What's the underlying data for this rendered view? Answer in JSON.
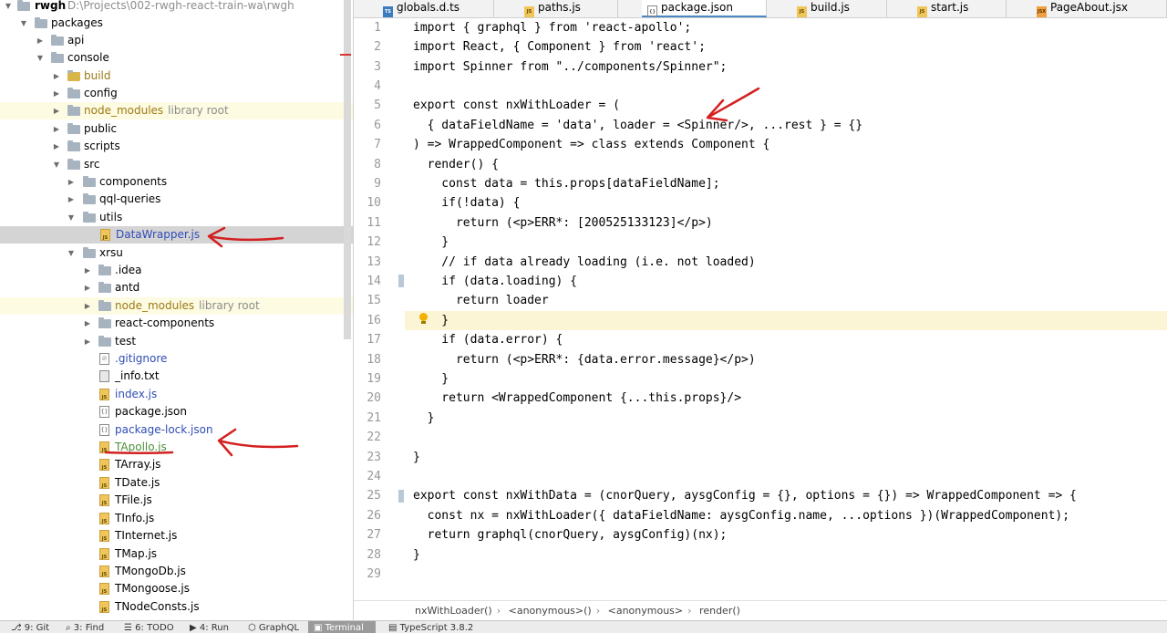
{
  "project_tree": {
    "root": {
      "name": "rwgh",
      "path": "D:\\Projects\\002-rwgh-react-train-wa\\rwgh"
    },
    "items": [
      {
        "label": "packages"
      },
      {
        "label": "api"
      },
      {
        "label": "console"
      },
      {
        "label": "build"
      },
      {
        "label": "config"
      },
      {
        "label": "node_modules",
        "note": "library root"
      },
      {
        "label": "public"
      },
      {
        "label": "scripts"
      },
      {
        "label": "src"
      },
      {
        "label": "components"
      },
      {
        "label": "qql-queries"
      },
      {
        "label": "utils"
      },
      {
        "label": "DataWrapper.js"
      },
      {
        "label": "xrsu"
      },
      {
        "label": ".idea"
      },
      {
        "label": "antd"
      },
      {
        "label": "node_modules",
        "note": "library root"
      },
      {
        "label": "react-components"
      },
      {
        "label": "test"
      },
      {
        "label": ".gitignore"
      },
      {
        "label": "_info.txt"
      },
      {
        "label": "index.js"
      },
      {
        "label": "package.json"
      },
      {
        "label": "package-lock.json"
      },
      {
        "label": "TApollo.js"
      },
      {
        "label": "TArray.js"
      },
      {
        "label": "TDate.js"
      },
      {
        "label": "TFile.js"
      },
      {
        "label": "TInfo.js"
      },
      {
        "label": "TInternet.js"
      },
      {
        "label": "TMap.js"
      },
      {
        "label": "TMongoDb.js"
      },
      {
        "label": "TMongoose.js"
      },
      {
        "label": "TNodeConsts.js"
      }
    ]
  },
  "tabs": [
    {
      "label": "globals.d.ts",
      "icon": "ts-file-icon"
    },
    {
      "label": "paths.js",
      "icon": "js-file-icon"
    },
    {
      "label": "package.json",
      "icon": "json-file-icon"
    },
    {
      "label": "build.js",
      "icon": "js-file-icon"
    },
    {
      "label": "start.js",
      "icon": "js-file-icon"
    },
    {
      "label": "PageAbout.jsx",
      "icon": "jsx-file-icon"
    }
  ],
  "editor": {
    "line_numbers": [
      "1",
      "2",
      "3",
      "4",
      "5",
      "6",
      "7",
      "8",
      "9",
      "10",
      "11",
      "12",
      "13",
      "14",
      "15",
      "16",
      "17",
      "18",
      "19",
      "20",
      "21",
      "22",
      "23",
      "24",
      "25",
      "26",
      "27",
      "28",
      "29"
    ],
    "lines": [
      "import { graphql } from 'react-apollo';",
      "import React, { Component } from 'react';",
      "import Spinner from \"../components/Spinner\";",
      "",
      "export const nxWithLoader = (",
      "  { dataFieldName = 'data', loader = <Spinner/>, ...rest } = {}",
      ") => WrappedComponent => class extends Component {",
      "  render() {",
      "    const data = this.props[dataFieldName];",
      "    if(!data) {",
      "      return (<p>ERR*: [200525133123]</p>)",
      "    }",
      "    // if data already loading (i.e. not loaded)",
      "    if (data.loading) {",
      "      return loader",
      "    }",
      "    if (data.error) {",
      "      return (<p>ERR*: {data.error.message}</p>)",
      "    }",
      "    return <WrappedComponent {...this.props}/>",
      "  }",
      "",
      "}",
      "",
      "export const nxWithData = (cnorQuery, aysgConfig = {}, options = {}) => WrappedComponent => {",
      "  const nx = nxWithLoader({ dataFieldName: aysgConfig.name, ...options })(WrappedComponent);",
      "  return graphql(cnorQuery, aysgConfig)(nx);",
      "}",
      ""
    ]
  },
  "breadcrumb": [
    "nxWithLoader()",
    "<anonymous>()",
    "<anonymous>",
    "render()"
  ],
  "bottom_bar": [
    {
      "label": "9: Git"
    },
    {
      "label": "3: Find"
    },
    {
      "label": "6: TODO"
    },
    {
      "label": "4: Run"
    },
    {
      "label": "GraphQL"
    },
    {
      "label": "Terminal"
    },
    {
      "label": "TypeScript 3.8.2"
    }
  ],
  "colors": {
    "keyword": "#000080",
    "string": "#2e7d32",
    "comment": "#888888",
    "annotation": "#d32020",
    "current_line": "#fcf5d5",
    "selected_row": "#d4d4d4"
  }
}
